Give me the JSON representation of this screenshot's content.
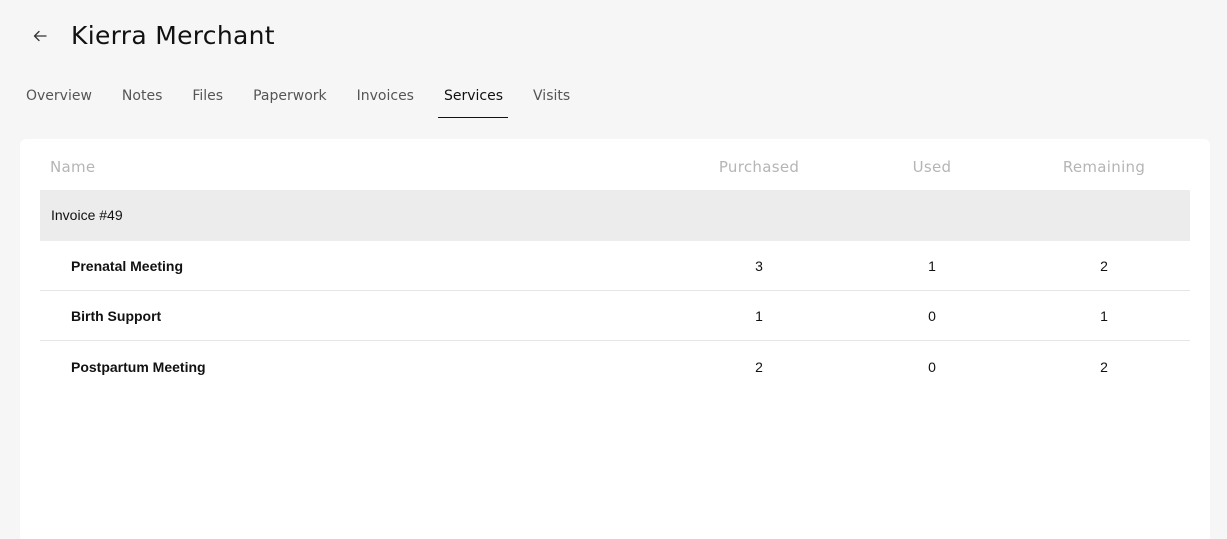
{
  "header": {
    "back_label": "Back",
    "title": "Kierra Merchant"
  },
  "tabs": [
    {
      "label": "Overview",
      "active": false
    },
    {
      "label": "Notes",
      "active": false
    },
    {
      "label": "Files",
      "active": false
    },
    {
      "label": "Paperwork",
      "active": false
    },
    {
      "label": "Invoices",
      "active": false
    },
    {
      "label": "Services",
      "active": true
    },
    {
      "label": "Visits",
      "active": false
    }
  ],
  "table": {
    "columns": {
      "name": "Name",
      "purchased": "Purchased",
      "used": "Used",
      "remaining": "Remaining"
    },
    "group": {
      "label": "Invoice #49"
    },
    "rows": [
      {
        "name": "Prenatal Meeting",
        "purchased": "3",
        "used": "1",
        "remaining": "2"
      },
      {
        "name": "Birth Support",
        "purchased": "1",
        "used": "0",
        "remaining": "1"
      },
      {
        "name": "Postpartum Meeting",
        "purchased": "2",
        "used": "0",
        "remaining": "2"
      }
    ]
  }
}
